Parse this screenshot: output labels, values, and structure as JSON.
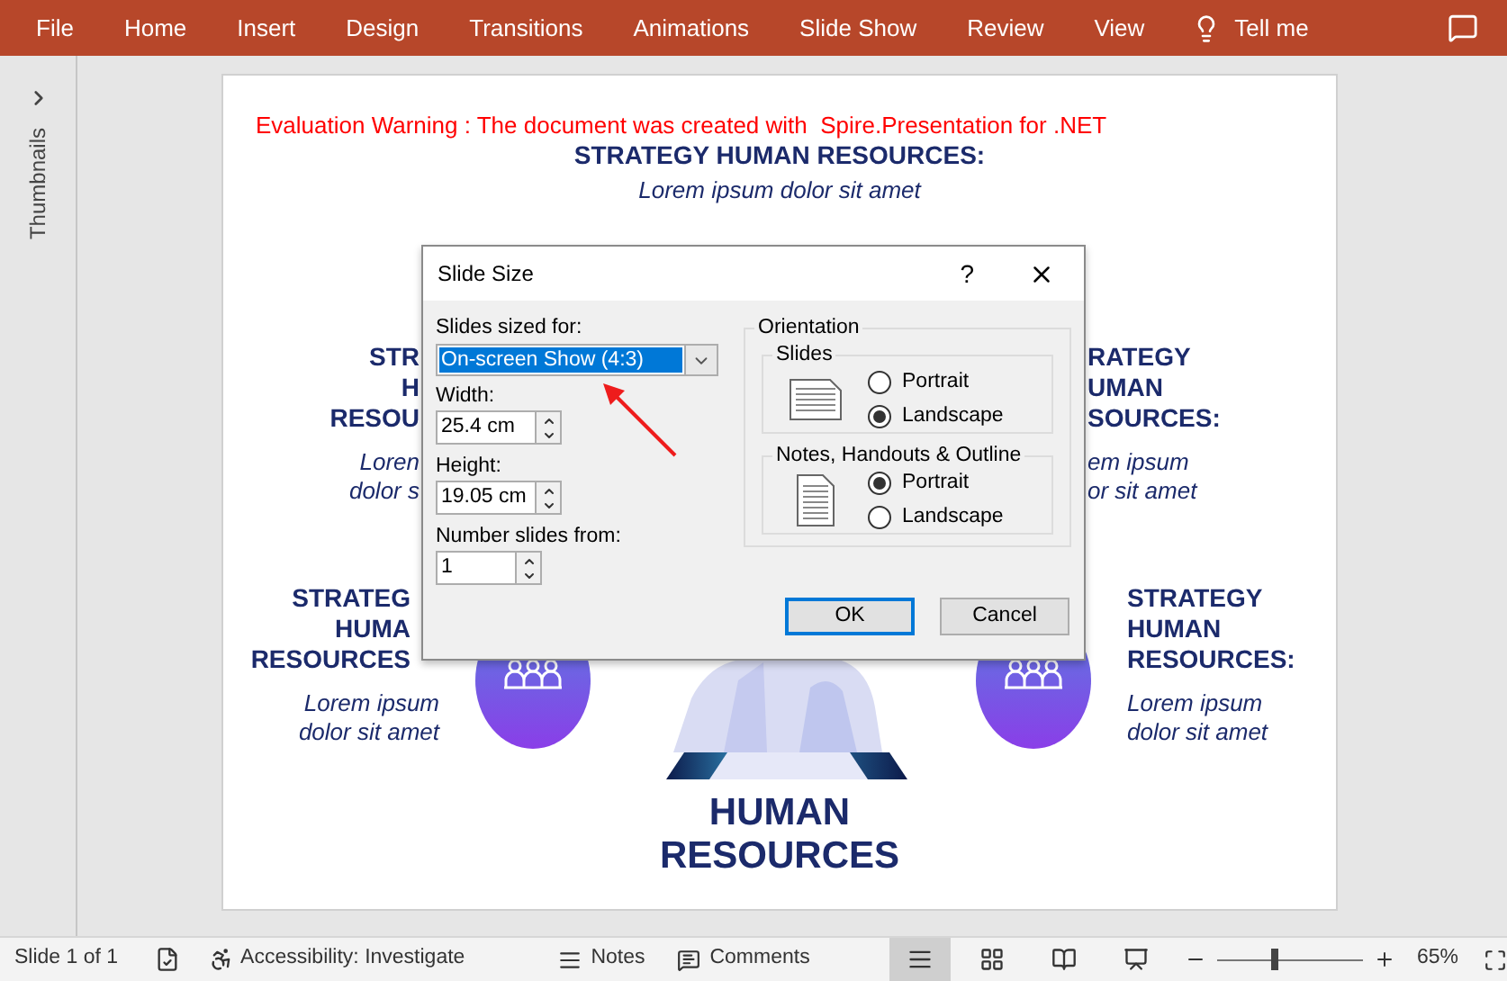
{
  "ribbon": {
    "tabs": [
      "File",
      "Home",
      "Insert",
      "Design",
      "Transitions",
      "Animations",
      "Slide Show",
      "Review",
      "View"
    ],
    "tell_me": "Tell me"
  },
  "thumbnails_pane": {
    "label": "Thumbnails"
  },
  "slide": {
    "warning": "Evaluation Warning : The document was created with  Spire.Presentation for .NET",
    "title": "STRATEGY HUMAN RESOURCES:",
    "subtitle": "Lorem ipsum dolor sit amet",
    "blocks": [
      {
        "heading": [
          "STR",
          "H",
          "RESOU"
        ],
        "text": [
          "Loren",
          "dolor s"
        ]
      },
      {
        "heading": [
          "RATEGY",
          "UMAN",
          "SOURCES:"
        ],
        "text": [
          "em ipsum",
          "or sit amet"
        ]
      },
      {
        "heading": [
          "STRATEG",
          "HUMA",
          "RESOURCES"
        ],
        "text": [
          "Lorem ipsum",
          "dolor sit amet"
        ]
      },
      {
        "heading": [
          "STRATEGY",
          "HUMAN",
          "RESOURCES:"
        ],
        "text": [
          "Lorem ipsum",
          "dolor sit amet"
        ]
      }
    ],
    "center_title": [
      "HUMAN",
      "RESOURCES"
    ]
  },
  "dialog": {
    "title": "Slide Size",
    "help": "?",
    "sized_for": {
      "label": "Slides sized for:",
      "value": "On-screen Show (4:3)"
    },
    "width": {
      "label": "Width:",
      "value": "25.4 cm"
    },
    "height": {
      "label": "Height:",
      "value": "19.05 cm"
    },
    "number_from": {
      "label": "Number slides from:",
      "value": "1"
    },
    "orientation": {
      "label": "Orientation",
      "groups": [
        {
          "label": "Slides",
          "kind": "landscape",
          "options": [
            {
              "label": "Portrait",
              "selected": false
            },
            {
              "label": "Landscape",
              "selected": true
            }
          ]
        },
        {
          "label": "Notes, Handouts & Outline",
          "kind": "portrait",
          "options": [
            {
              "label": "Portrait",
              "selected": true
            },
            {
              "label": "Landscape",
              "selected": false
            }
          ]
        }
      ]
    },
    "buttons": [
      {
        "label": "OK",
        "kind": "default"
      },
      {
        "label": "Cancel",
        "kind": "normal"
      }
    ]
  },
  "status_bar": {
    "slide": "Slide 1 of 1",
    "accessibility": "Accessibility: Investigate",
    "notes": "Notes",
    "comments": "Comments",
    "views": [
      {
        "kind": "normal",
        "selected": true
      },
      {
        "kind": "sorter",
        "selected": false
      },
      {
        "kind": "reading",
        "selected": false
      },
      {
        "kind": "slideshow",
        "selected": false
      }
    ],
    "zoom": {
      "level": 0.4,
      "reading": "65%"
    }
  }
}
